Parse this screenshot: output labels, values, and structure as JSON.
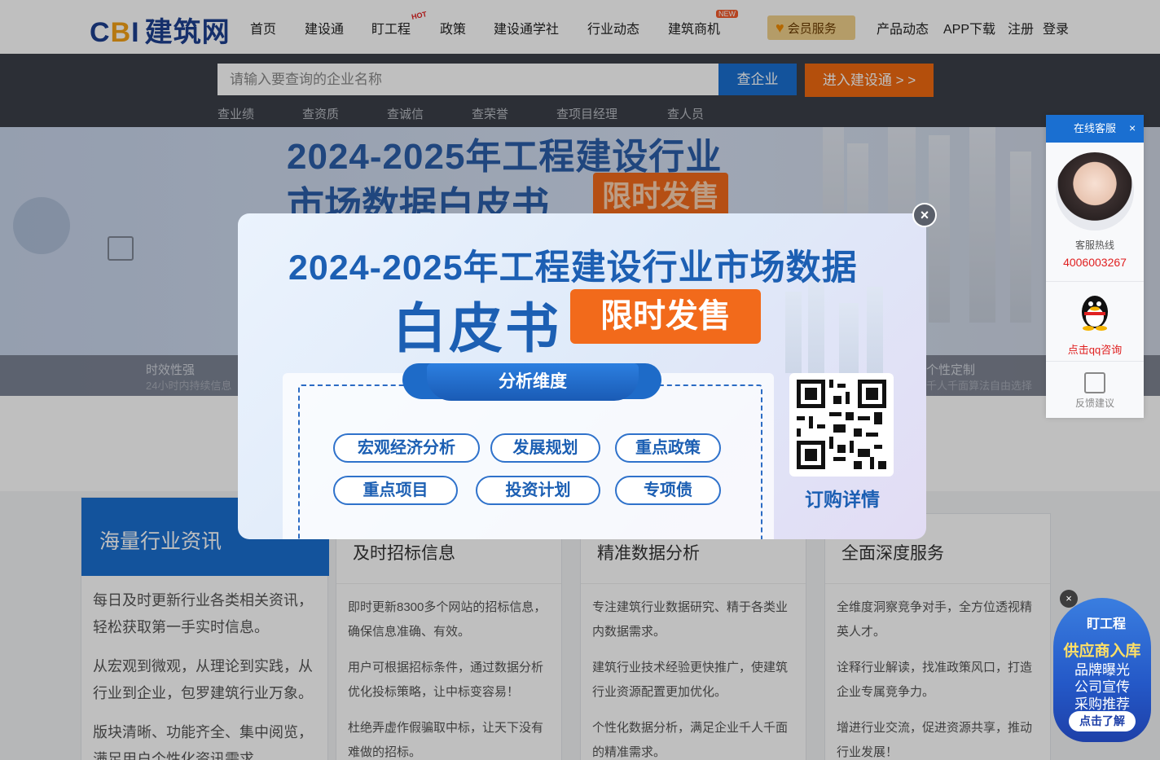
{
  "header": {
    "logo_text": "CBI",
    "logo_cn": "建筑网",
    "nav": [
      "首页",
      "建设通",
      "盯工程",
      "政策",
      "建设通学社",
      "行业动态",
      "建筑商机"
    ],
    "hot_badge": "HOT",
    "new_badge": "NEW",
    "vip_label": "会员服务",
    "right_links": [
      "产品动态",
      "APP下载",
      "注册",
      "登录"
    ]
  },
  "search": {
    "placeholder": "请输入要查询的企业名称",
    "button": "查企业",
    "enter_button": "进入建设通 > >",
    "quick_links": [
      "查业绩",
      "查资质",
      "查诚信",
      "查荣誉",
      "查项目经理",
      "查人员"
    ]
  },
  "banner": {
    "title_line1": "2024-2025年工程建设行业",
    "title_line2": "市场数据白皮书",
    "tag": "限时发售",
    "features": [
      {
        "title": "时效性强",
        "desc": "24小时内持续信息"
      },
      {
        "title": "个性定制",
        "desc": "千人千面算法自由选择"
      }
    ]
  },
  "cards": {
    "card1": {
      "title": "海量行业资讯",
      "paras": [
        "每日及时更新行业各类相关资讯，轻松获取第一手实时信息。",
        "从宏观到微观，从理论到实践，从行业到企业，包罗建筑行业万象。",
        "版块清晰、功能齐全、集中阅览，满足用户个性化资讯需求。"
      ]
    },
    "card2": {
      "title": "及时招标信息",
      "paras": [
        "即时更新8300多个网站的招标信息，确保信息准确、有效。",
        "用户可根据招标条件，通过数据分析优化投标策略，让中标变容易！",
        "杜绝弄虚作假骗取中标，让天下没有难做的招标。"
      ]
    },
    "card3": {
      "title": "精准数据分析",
      "paras": [
        "专注建筑行业数据研究、精于各类业内数据需求。",
        "建筑行业技术经验更快推广，使建筑行业资源配置更加优化。",
        "个性化数据分析，满足企业千人千面的精准需求。"
      ]
    },
    "card4": {
      "title": "全面深度服务",
      "paras": [
        "全维度洞察竞争对手，全方位透视精英人才。",
        "诠释行业解读，找准政策风口，打造企业专属竞争力。",
        "增进行业交流，促进资源共享，推动行业发展！"
      ]
    }
  },
  "popup": {
    "title": "2024-2025年工程建设行业市场数据",
    "big": "白皮书",
    "tag": "限时发售",
    "tab": "分析维度",
    "pills": [
      "宏观经济分析",
      "发展规划",
      "重点政策",
      "重点项目",
      "投资计划",
      "专项债"
    ],
    "qr_label": "订购详情",
    "close": "×"
  },
  "service": {
    "header": "在线客服",
    "close": "×",
    "hotline_label": "客服热线",
    "phone": "4006003267",
    "qq_label": "点击qq咨询",
    "feedback": "反馈建议"
  },
  "supplier": {
    "close": "×",
    "logo": "盯工程",
    "title": "供应商入库",
    "lines": [
      "品牌曝光",
      "公司宣传",
      "采购推荐"
    ],
    "button": "点击了解"
  },
  "colors": {
    "brand_blue": "#1a6fd1",
    "accent_orange": "#f06a10",
    "hotline_red": "#e02020"
  }
}
